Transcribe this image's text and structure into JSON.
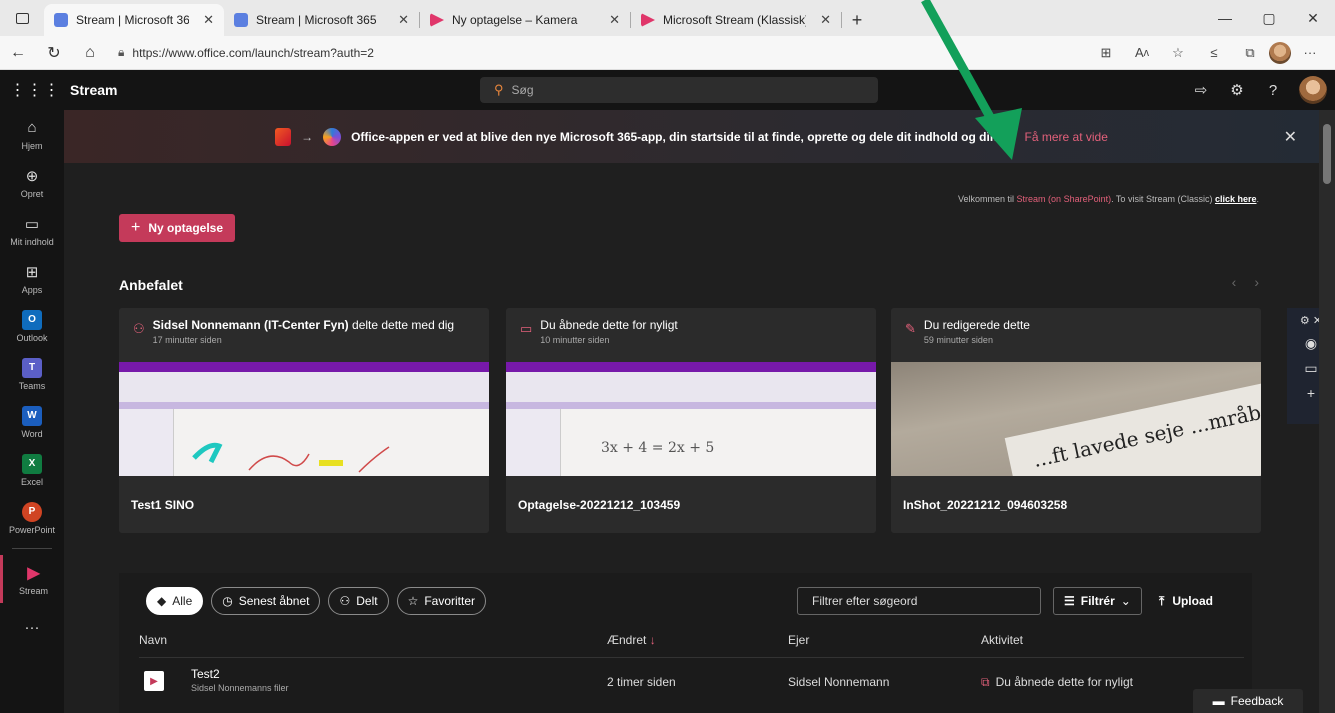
{
  "browser": {
    "tabs": [
      {
        "label": "Stream | Microsoft 365",
        "active": true,
        "fav_color": "#5b7fe0"
      },
      {
        "label": "Stream | Microsoft 365",
        "active": false,
        "fav_color": "#5b7fe0"
      },
      {
        "label": "Ny optagelse – Kamera",
        "active": false,
        "fav_color": "#e0366a"
      },
      {
        "label": "Microsoft Stream (Klassisk)",
        "active": false,
        "fav_color": "#e0366a"
      }
    ],
    "url": "https://www.office.com/launch/stream?auth=2"
  },
  "topbar": {
    "app_name": "Stream",
    "search_placeholder": "Søg"
  },
  "rail": [
    {
      "label": "Hjem",
      "icon": "home-icon"
    },
    {
      "label": "Opret",
      "icon": "plus-circle-icon"
    },
    {
      "label": "Mit indhold",
      "icon": "folder-icon"
    },
    {
      "label": "Apps",
      "icon": "apps-icon"
    },
    {
      "label": "Outlook",
      "tile": "O",
      "color": "#0f6cbd"
    },
    {
      "label": "Teams",
      "tile": "T",
      "color": "#5b5fc7"
    },
    {
      "label": "Word",
      "tile": "W",
      "color": "#1b5ebe"
    },
    {
      "label": "Excel",
      "tile": "X",
      "color": "#107c41"
    },
    {
      "label": "PowerPoint",
      "tile": "P",
      "color": "#d04423"
    },
    {
      "label": "Stream",
      "tile": "▶",
      "color": "#c43a5a"
    }
  ],
  "banner": {
    "text": "Office-appen er ved at blive den nye Microsoft 365-app, din startside til at finde, oprette og dele dit indhold og din",
    "text_end": "er.",
    "link": "Få mere at vide"
  },
  "welcome": {
    "prefix": "Velkommen til ",
    "link": "Stream (on SharePoint)",
    "middle": ". To visit Stream (Classic) ",
    "click": "click here",
    "suffix": "."
  },
  "new_button": "Ny optagelse",
  "section_title": "Anbefalet",
  "cards": [
    {
      "title_bold": "Sidsel Nonnemann (IT-Center Fyn)",
      "title_rest": " delte dette med dig",
      "sub": "17 minutter siden",
      "name": "Test1 SINO",
      "icon": "people-icon",
      "thumb": "onenote"
    },
    {
      "title_bold": "",
      "title_rest": "Du åbnede dette for nyligt",
      "sub": "10 minutter siden",
      "name": "Optagelse-20221212_103459",
      "icon": "folder-icon",
      "thumb": "onenote-math",
      "math": "3x + 4 = 2x + 5"
    },
    {
      "title_bold": "",
      "title_rest": "Du redigerede dette",
      "sub": "59 minutter siden",
      "name": "InShot_20221212_094603258",
      "icon": "pencil-icon",
      "thumb": "photo",
      "photo_text": "...ft lavede seje ...mråb"
    }
  ],
  "filters": {
    "pills": [
      "Alle",
      "Senest åbnet",
      "Delt",
      "Favoritter"
    ],
    "search_placeholder": "Filtrer efter søgeord",
    "filter_label": "Filtrér",
    "upload_label": "Upload"
  },
  "table": {
    "headers": {
      "name": "Navn",
      "changed": "Ændret",
      "owner": "Ejer",
      "activity": "Aktivitet"
    },
    "rows": [
      {
        "name": "Test2",
        "sub": "Sidsel Nonnemanns filer",
        "changed": "2 timer siden",
        "owner": "Sidsel Nonnemann",
        "activity": "Du åbnede dette for nyligt"
      }
    ]
  },
  "feedback": "Feedback",
  "colors": {
    "accent": "#c43a5a",
    "link": "#e2607a",
    "annotation_arrow": "#13a05a"
  }
}
